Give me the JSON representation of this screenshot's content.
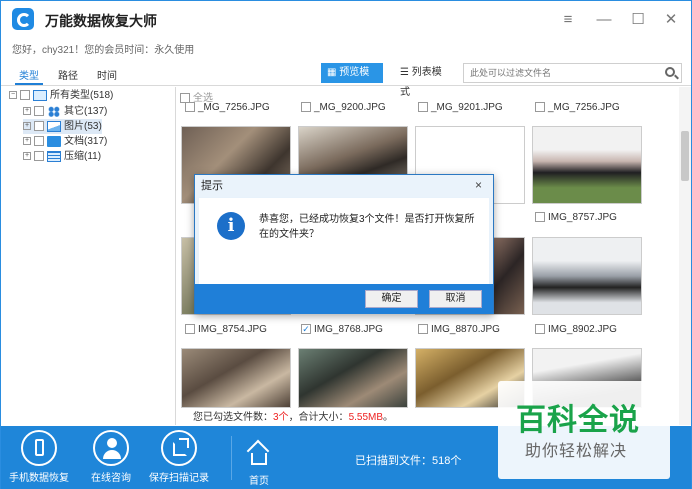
{
  "app": {
    "title": "万能数据恢复大师",
    "user_info": "您好，chy321！您的会员时间：永久使用"
  },
  "window_controls": {
    "menu_icon": "≡",
    "minimize_icon": "—",
    "maximize_icon": "☐",
    "close_icon": "✕"
  },
  "left_tabs": [
    {
      "label": "类型",
      "active": true
    },
    {
      "label": "路径",
      "active": false
    },
    {
      "label": "时间",
      "active": false
    }
  ],
  "view": {
    "preview_label": "预览模式",
    "list_label": "列表模式",
    "filter_placeholder": "此处可以过滤文件名"
  },
  "tree": {
    "root": "所有类型(518)",
    "children": [
      {
        "label": "其它(137)",
        "icon": "apps-icon"
      },
      {
        "label": "图片(53)",
        "icon": "image-icon"
      },
      {
        "label": "文档(317)",
        "icon": "folder-icon"
      },
      {
        "label": "压缩(11)",
        "icon": "archive-icon"
      }
    ]
  },
  "grid": {
    "select_all": "全选",
    "top_captions": [
      "_MG_7256.JPG",
      "_MG_9200.JPG",
      "_MG_9201.JPG",
      "_MG_7256.JPG"
    ],
    "row1_captions": [
      "IMG_8757.JPG"
    ],
    "row2_captions": [
      "IMG_8754.JPG",
      "IMG_8768.JPG",
      "IMG_8870.JPG",
      "IMG_8902.JPG"
    ],
    "row2_checked": [
      false,
      true,
      false,
      false
    ]
  },
  "status": {
    "prefix": "您已勾选文件数：",
    "count": "3个",
    "middle": "，合计大小：",
    "size": "5.55MB",
    "suffix": "。"
  },
  "bottom": {
    "buttons": [
      {
        "label": "手机数据恢复",
        "icon": "phone-icon"
      },
      {
        "label": "在线咨询",
        "icon": "user-icon"
      },
      {
        "label": "保存扫描记录",
        "icon": "export-icon"
      },
      {
        "label": "首页",
        "icon": "home-icon"
      }
    ],
    "scanned": "已扫描到文件：518个"
  },
  "dialog": {
    "title": "提示",
    "close": "×",
    "message": "恭喜您，已经成功恢复3个文件！是否打开恢复所在的文件夹？",
    "ok": "确定",
    "cancel": "取消"
  },
  "watermark": {
    "line1": "百科全说",
    "line2": "助你轻松解决"
  }
}
